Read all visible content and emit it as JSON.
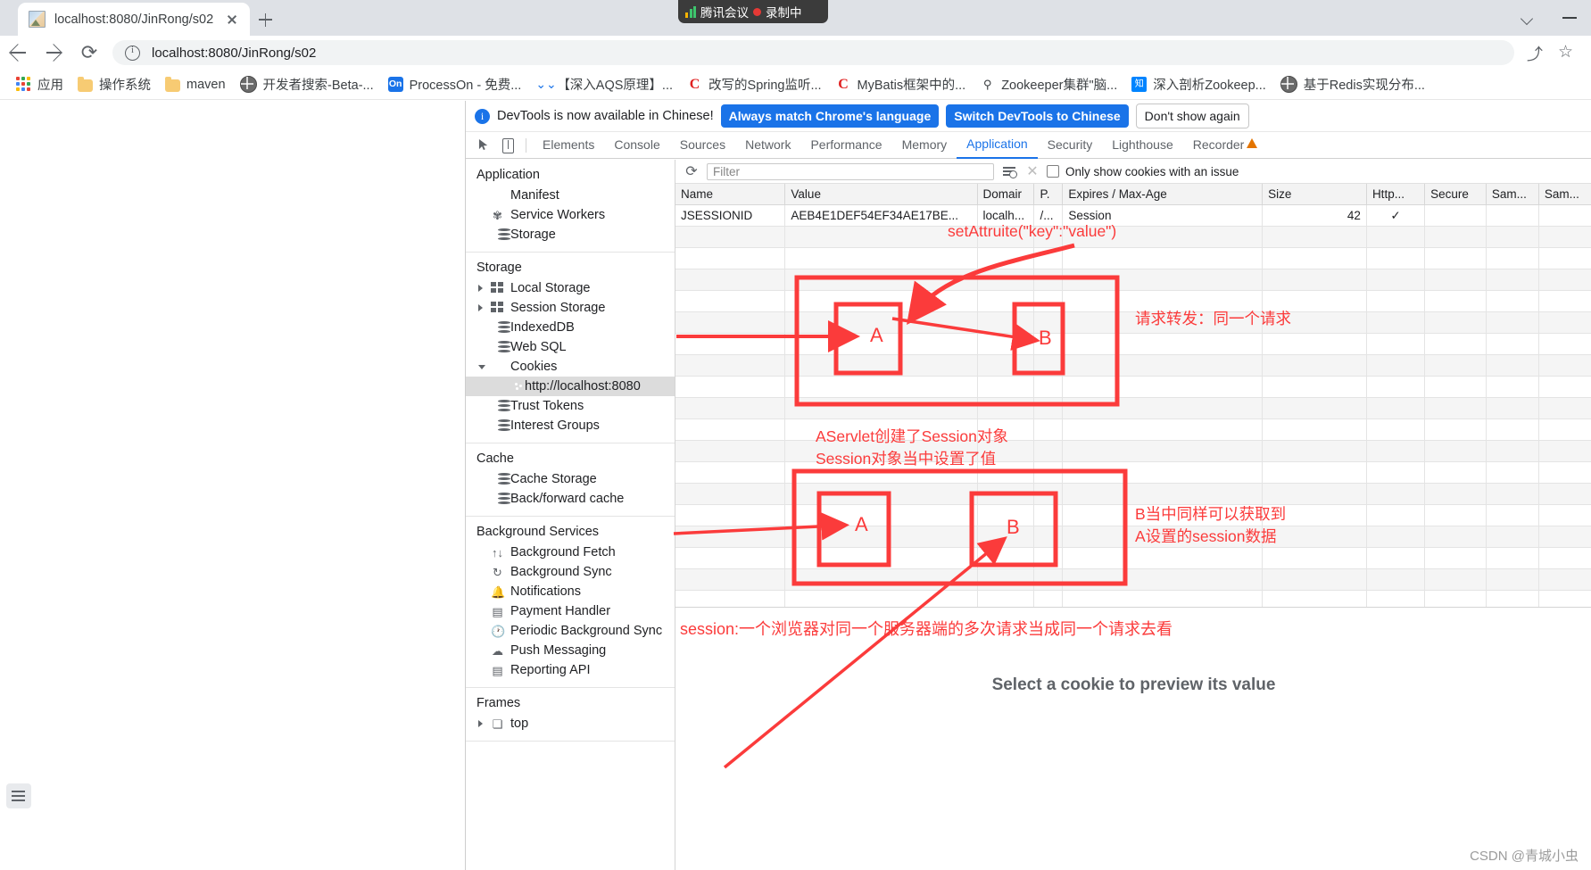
{
  "browser": {
    "tab": {
      "title": "localhost:8080/JinRong/s02",
      "favicon": "image-favicon",
      "close": "close-icon"
    },
    "new_tab": "new-tab-icon",
    "recording_pill": {
      "label": "腾讯会议",
      "status": "录制中"
    },
    "window_controls": {
      "expand": "chevron-down-icon",
      "minimize": "minimize-icon"
    },
    "omnibox": {
      "url": "localhost:8080/JinRong/s02",
      "info_icon": "info-icon"
    },
    "nav": {
      "back": "back-arrow-icon",
      "forward": "forward-arrow-icon",
      "reload": "reload-icon"
    },
    "actions": {
      "share": "share-icon",
      "bookmark": "star-icon"
    },
    "bookmarks": [
      {
        "label": "应用",
        "icon": "apps-grid-icon"
      },
      {
        "label": "操作系统",
        "icon": "folder-icon"
      },
      {
        "label": "maven",
        "icon": "folder-icon"
      },
      {
        "label": "开发者搜索-Beta-...",
        "icon": "globe-icon"
      },
      {
        "label": "ProcessOn - 免费...",
        "icon": "on-icon"
      },
      {
        "label": "【深入AQS原理】...",
        "icon": "double-chevron-down-icon"
      },
      {
        "label": "改写的Spring监听...",
        "icon": "csdn-icon"
      },
      {
        "label": "MyBatis框架中的...",
        "icon": "csdn-icon"
      },
      {
        "label": "Zookeeper集群\"脑...",
        "icon": "zookeeper-icon"
      },
      {
        "label": "深入剖析Zookeep...",
        "icon": "zhihu-icon"
      },
      {
        "label": "基于Redis实现分布...",
        "icon": "globe-icon"
      }
    ]
  },
  "devtools": {
    "notice": {
      "icon": "info-icon",
      "text": "DevTools is now available in Chinese!",
      "btn_always": "Always match Chrome's language",
      "btn_switch": "Switch DevTools to Chinese",
      "btn_dismiss": "Don't show again"
    },
    "toolbar_icons": {
      "inspect": "inspect-element-icon",
      "device": "device-toolbar-icon",
      "warning": "warning-triangle-icon"
    },
    "tabs": [
      {
        "label": "Elements",
        "active": false
      },
      {
        "label": "Console",
        "active": false
      },
      {
        "label": "Sources",
        "active": false
      },
      {
        "label": "Network",
        "active": false
      },
      {
        "label": "Performance",
        "active": false
      },
      {
        "label": "Memory",
        "active": false
      },
      {
        "label": "Application",
        "active": true
      },
      {
        "label": "Security",
        "active": false
      },
      {
        "label": "Lighthouse",
        "active": false
      },
      {
        "label": "Recorder",
        "active": false
      }
    ],
    "sidebar": [
      {
        "head": "Application",
        "items": [
          {
            "label": "Manifest",
            "icon": "page-icon",
            "caret": "none",
            "selected": false,
            "nested": false
          },
          {
            "label": "Service Workers",
            "icon": "gear-icon",
            "caret": "none",
            "selected": false,
            "nested": false
          },
          {
            "label": "Storage",
            "icon": "database-icon",
            "caret": "none",
            "selected": false,
            "nested": false
          }
        ]
      },
      {
        "head": "Storage",
        "items": [
          {
            "label": "Local Storage",
            "icon": "grid-icon",
            "caret": "closed",
            "selected": false,
            "nested": false
          },
          {
            "label": "Session Storage",
            "icon": "grid-icon",
            "caret": "closed",
            "selected": false,
            "nested": false
          },
          {
            "label": "IndexedDB",
            "icon": "database-icon",
            "caret": "none",
            "selected": false,
            "nested": false
          },
          {
            "label": "Web SQL",
            "icon": "database-icon",
            "caret": "none",
            "selected": false,
            "nested": false
          },
          {
            "label": "Cookies",
            "icon": "cookie-icon",
            "caret": "open",
            "selected": false,
            "nested": false
          },
          {
            "label": "http://localhost:8080",
            "icon": "cookie-icon",
            "caret": "none",
            "selected": true,
            "nested": true
          },
          {
            "label": "Trust Tokens",
            "icon": "database-icon",
            "caret": "none",
            "selected": false,
            "nested": false
          },
          {
            "label": "Interest Groups",
            "icon": "database-icon",
            "caret": "none",
            "selected": false,
            "nested": false
          }
        ]
      },
      {
        "head": "Cache",
        "items": [
          {
            "label": "Cache Storage",
            "icon": "database-icon",
            "caret": "none",
            "selected": false,
            "nested": false
          },
          {
            "label": "Back/forward cache",
            "icon": "database-icon",
            "caret": "none",
            "selected": false,
            "nested": false
          }
        ]
      },
      {
        "head": "Background Services",
        "items": [
          {
            "label": "Background Fetch",
            "icon": "updown-arrows-icon",
            "caret": "none",
            "selected": false,
            "nested": false
          },
          {
            "label": "Background Sync",
            "icon": "sync-icon",
            "caret": "none",
            "selected": false,
            "nested": false
          },
          {
            "label": "Notifications",
            "icon": "bell-icon",
            "caret": "none",
            "selected": false,
            "nested": false
          },
          {
            "label": "Payment Handler",
            "icon": "card-icon",
            "caret": "none",
            "selected": false,
            "nested": false
          },
          {
            "label": "Periodic Background Sync",
            "icon": "clock-icon",
            "caret": "none",
            "selected": false,
            "nested": false
          },
          {
            "label": "Push Messaging",
            "icon": "cloud-icon",
            "caret": "none",
            "selected": false,
            "nested": false
          },
          {
            "label": "Reporting API",
            "icon": "report-icon",
            "caret": "none",
            "selected": false,
            "nested": false
          }
        ]
      },
      {
        "head": "Frames",
        "items": [
          {
            "label": "top",
            "icon": "frame-icon",
            "caret": "closed",
            "selected": false,
            "nested": false
          }
        ]
      }
    ],
    "cookies": {
      "refresh_icon": "refresh-icon",
      "filter_placeholder": "Filter",
      "filter_value": "",
      "filter_icon": "filter-list-icon",
      "clear_icon": "clear-x-icon",
      "issues_checkbox_label": "Only show cookies with an issue",
      "issues_checked": false,
      "columns": [
        "Name",
        "Value",
        "Domair",
        "P.",
        "Expires / Max-Age",
        "Size",
        "Http...",
        "Secure",
        "Sam...",
        "Sam..."
      ],
      "rows": [
        {
          "Name": "JSESSIONID",
          "Value": "AEB4E1DEF54EF34AE17BE...",
          "Domair": "localh...",
          "P.": "/...",
          "Expires / Max-Age": "Session",
          "Size": "42",
          "Http...": "✓",
          "Secure": "",
          "Sam...": "",
          "Sam2": ""
        }
      ],
      "preview_message": "Select a cookie to preview its value"
    }
  },
  "annotations": {
    "set_attribute": "setAttruite(\"key\":\"value\")",
    "forward_note": "请求转发：同一个请求",
    "session_created": "AServlet创建了Session对象\nSession对象当中设置了值",
    "b_can_get": "B当中同样可以获取到\nA设置的session数据",
    "session_desc": "session:一个浏览器对同一个服务器端的多次请求当成同一个请求去看",
    "box_a_label": "A",
    "box_b_label": "B",
    "accent_color": "#fb3b3b"
  },
  "watermark": "CSDN @青城小虫"
}
